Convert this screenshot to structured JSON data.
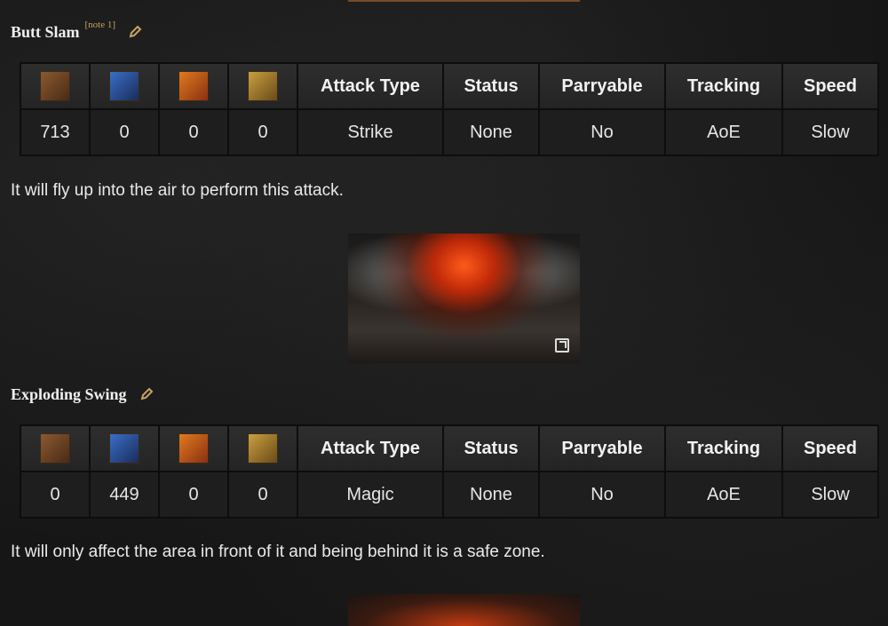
{
  "sections": [
    {
      "title": "Butt Slam",
      "note": "[note 1]",
      "headers": {
        "attack_type": "Attack Type",
        "status": "Status",
        "parryable": "Parryable",
        "tracking": "Tracking",
        "speed": "Speed"
      },
      "row": {
        "physical": "713",
        "magic": "0",
        "fire": "0",
        "lightning": "0",
        "attack_type": "Strike",
        "status": "None",
        "parryable": "No",
        "tracking": "AoE",
        "speed": "Slow"
      },
      "description": "It will fly up into the air to perform this attack."
    },
    {
      "title": "Exploding Swing",
      "headers": {
        "attack_type": "Attack Type",
        "status": "Status",
        "parryable": "Parryable",
        "tracking": "Tracking",
        "speed": "Speed"
      },
      "row": {
        "physical": "0",
        "magic": "449",
        "fire": "0",
        "lightning": "0",
        "attack_type": "Magic",
        "status": "None",
        "parryable": "No",
        "tracking": "AoE",
        "speed": "Slow"
      },
      "description": "It will only affect the area in front of it and being behind it is a safe zone."
    }
  ],
  "icons": {
    "physical": "physical-damage-icon",
    "magic": "magic-damage-icon",
    "fire": "fire-damage-icon",
    "lightning": "lightning-damage-icon",
    "edit": "pencil-edit-icon",
    "expand": "expand-image-icon"
  },
  "colors": {
    "link": "#c9a465",
    "note": "#c8a060",
    "background": "#161616"
  }
}
